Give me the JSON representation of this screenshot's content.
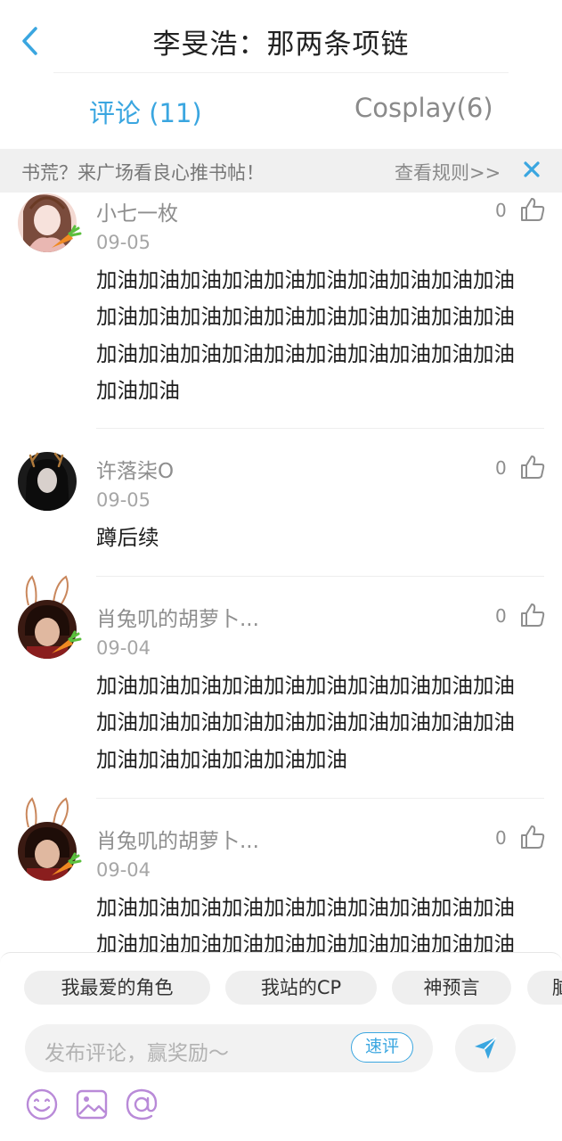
{
  "header": {
    "title": "李旻浩：那两条项链"
  },
  "tabs": [
    {
      "label": "评论 (11)",
      "active": true
    },
    {
      "label": "Cosplay(6)",
      "active": false
    }
  ],
  "notice": {
    "text": "书荒？来广场看良心推书帖！",
    "link": "查看规则>>"
  },
  "comments": [
    {
      "name": "小七一枚",
      "date": "09-05",
      "likes": "0",
      "text": "加油加油加油加油加油加油加油加油加油加油加油加油加油加油加油加油加油加油加油加油加油加油加油加油加油加油加油加油加油加油加油加油"
    },
    {
      "name": "许落柒O",
      "date": "09-05",
      "likes": "0",
      "text": "蹲后续"
    },
    {
      "name": "肖兔叽的胡萝卜...",
      "date": "09-04",
      "likes": "0",
      "text": "加油加油加油加油加油加油加油加油加油加油加油加油加油加油加油加油加油加油加油加油加油加油加油加油加油加油"
    },
    {
      "name": "肖兔叽的胡萝卜...",
      "date": "09-04",
      "likes": "0",
      "text": "加油加油加油加油加油加油加油加油加油加油加油加油加油加油加油加油加油加油加油加油加油加油加油加油加油加油"
    }
  ],
  "quick_tags": [
    "我最爱的角色",
    "我站的CP",
    "神预言",
    "脑"
  ],
  "composer": {
    "placeholder": "发布评论，赢奖励～",
    "quick_label": "速评"
  },
  "colors": {
    "accent": "#3aa6e0",
    "tool_icon": "#b98ad8"
  },
  "icons": [
    "back-icon",
    "close-icon",
    "like-icon",
    "send-icon",
    "emoji-icon",
    "image-icon",
    "mention-icon"
  ]
}
